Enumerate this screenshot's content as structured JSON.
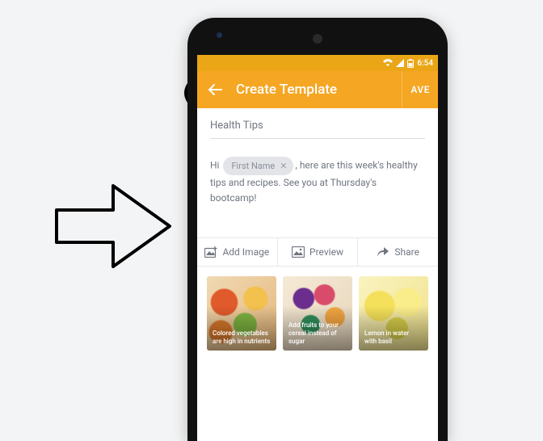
{
  "status_bar": {
    "time": "6:54"
  },
  "app_bar": {
    "title": "Create Template",
    "save_label": "AVE"
  },
  "content": {
    "subject": "Health Tips",
    "body_pre": "Hi ",
    "chip_label": "First Name",
    "body_post": ", here are this week's healthy tips and recipes. See you at Thursday's bootcamp!"
  },
  "toolbar": {
    "add_image": "Add Image",
    "preview": "Preview",
    "share": "Share"
  },
  "cards": [
    {
      "caption": "Colored vegetables are high in nutrients"
    },
    {
      "caption": "Add fruits to your cereal instead of sugar"
    },
    {
      "caption": "Lemon in water with basil"
    }
  ]
}
